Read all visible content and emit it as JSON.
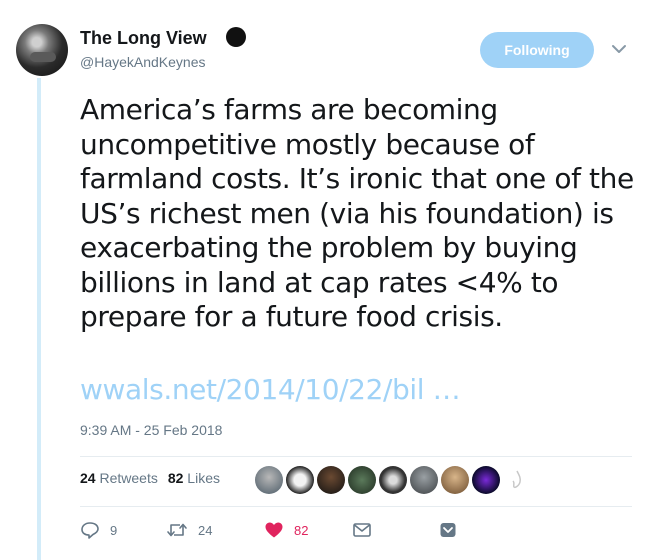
{
  "author": {
    "display_name": "The Long View",
    "handle": "@HayekAndKeynes"
  },
  "follow_button_label": "Following",
  "tweet": {
    "text": "America’s farms are becoming uncompetitive mostly because of farmland costs. It’s ironic that one of the US’s richest men (via his foundation) is exacerbating the problem by buying billions in land at cap rates <4% to prepare for a future food crisis.",
    "link": "wwals.net/2014/10/22/bil …",
    "timestamp": "9:39 AM - 25 Feb 2018"
  },
  "stats": {
    "retweets_count": "24",
    "retweets_label": "Retweets",
    "likes_count": "82",
    "likes_label": "Likes"
  },
  "actions": {
    "reply_count": "9",
    "retweet_count": "24",
    "like_count": "82"
  },
  "colors": {
    "accent": "#1da1f2",
    "follow_bg": "#9fd2f7",
    "like_red": "#e0245e",
    "muted": "#657786"
  },
  "icons": [
    "verified-dark-badge-icon",
    "chevron-down-icon",
    "reply-icon",
    "retweet-icon",
    "heart-icon",
    "message-icon",
    "bookmark-icon"
  ]
}
